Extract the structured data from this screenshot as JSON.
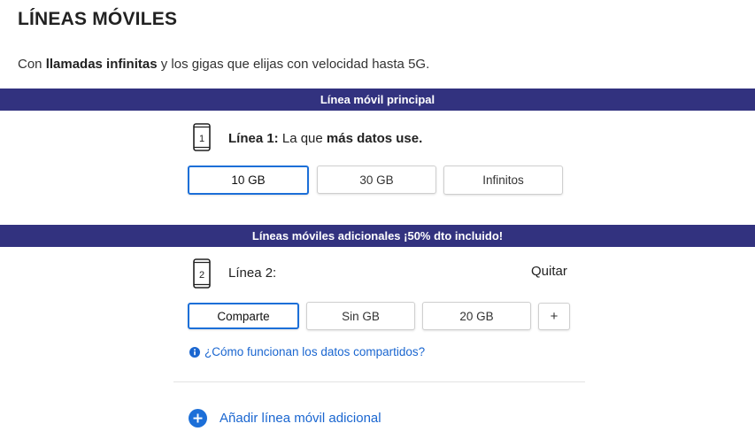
{
  "header": {
    "title": "LÍNEAS MÓVILES",
    "subtitle_pre": "Con ",
    "subtitle_bold": "llamadas infinitas",
    "subtitle_post": " y los gigas que elijas con velocidad hasta 5G."
  },
  "main_line": {
    "band": "Línea móvil principal",
    "phone_number": "1",
    "label_prefix": "Línea 1:",
    "label_text": " La que ",
    "label_bold": "más datos use.",
    "options": [
      "10 GB",
      "30 GB",
      "Infinitos"
    ],
    "selected": "10 GB"
  },
  "additional": {
    "band": "Líneas móviles adicionales ¡50% dto incluido!",
    "phone_number": "2",
    "label": "Línea 2:",
    "remove": "Quitar",
    "options": [
      "Comparte",
      "Sin GB",
      "20 GB"
    ],
    "more": "+",
    "selected": "Comparte",
    "help": "¿Cómo funcionan los datos compartidos?",
    "add_line": "Añadir línea móvil adicional"
  },
  "colors": {
    "band": "#32327f",
    "accent": "#1c6fd8",
    "link": "#1a66d0"
  }
}
